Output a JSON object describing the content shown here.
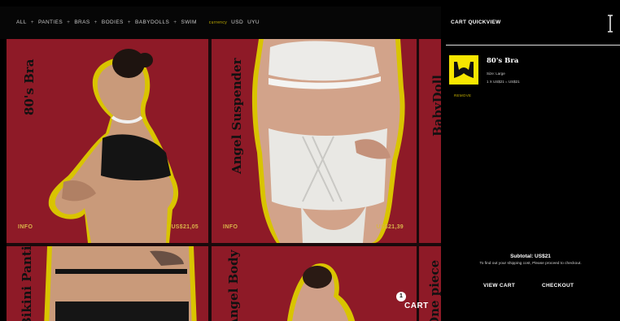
{
  "nav": {
    "items": [
      "ALL",
      "PANTIES",
      "BRAS",
      "BODIES",
      "BABYDOLLS",
      "SWIM"
    ],
    "separator": "+",
    "currency_label": "currency",
    "currencies": [
      "USD",
      "UYU"
    ]
  },
  "products": [
    {
      "title": "80's Bra",
      "info": "INFO",
      "price": "US$21,05"
    },
    {
      "title": "Angel Suspender",
      "info": "INFO",
      "price": "US$21,39"
    },
    {
      "title": "BabyDoll"
    },
    {
      "title": "Bikini Pantie"
    },
    {
      "title": "Angel Body"
    },
    {
      "title": "One piece"
    }
  ],
  "cart_button": {
    "count": "1",
    "label": "CART"
  },
  "quickview": {
    "title": "CART QUICKVIEW",
    "item": {
      "name": "80's Bra",
      "size": "Size: Large",
      "qty_price": "1 X US$21 = US$21"
    },
    "remove_label": "REMOVE",
    "subtotal": "Subtotal: US$21",
    "shipping_note": "To find out your shipping cost, Please proceed to checkout.",
    "view_cart_label": "VIEW CART",
    "checkout_label": "CHECKOUT"
  },
  "colors": {
    "tile_red": "#8e1a27",
    "outline_yellow": "#d9c400",
    "accent_yellow": "#c8b400",
    "thumb_yellow": "#f7e600"
  }
}
